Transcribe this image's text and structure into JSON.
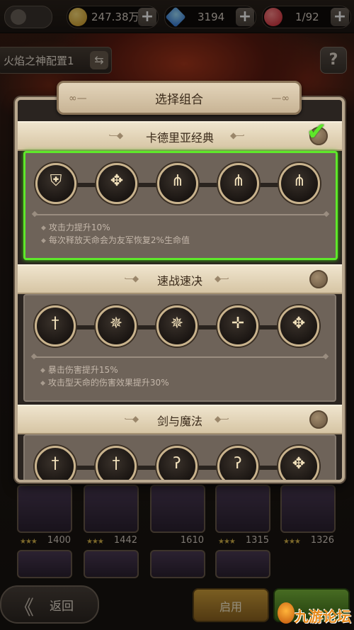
{
  "topbar": {
    "gold": "247.38万",
    "gems": "3194",
    "stamina": "1/92",
    "plus_label": "+"
  },
  "config": {
    "name": "火焰之神配置1",
    "swap_glyph": "⇆",
    "help_glyph": "?"
  },
  "modal": {
    "title": "选择组合",
    "combos": [
      {
        "name": "卡德里亚经典",
        "selected": true,
        "effects": [
          "攻击力提升10%",
          "每次释放天命会为友军恢复2%生命值"
        ]
      },
      {
        "name": "速战速决",
        "selected": false,
        "effects": [
          "暴击伤害提升15%",
          "攻击型天命的伤害效果提升30%"
        ]
      },
      {
        "name": "剑与魔法",
        "selected": false,
        "effects": []
      }
    ]
  },
  "roster": {
    "cards": [
      {
        "value": "1400"
      },
      {
        "value": "1442"
      },
      {
        "value": "1610"
      },
      {
        "value": "1315"
      },
      {
        "value": "1326"
      }
    ]
  },
  "bottom": {
    "back_label": "返回",
    "back_glyph": "《",
    "apply_label": "启用"
  },
  "watermark": {
    "text": "九游论坛"
  },
  "colors": {
    "selected_border": "#5ee82a",
    "ribbon": "#e3d4ba",
    "panel": "#6e6359"
  }
}
